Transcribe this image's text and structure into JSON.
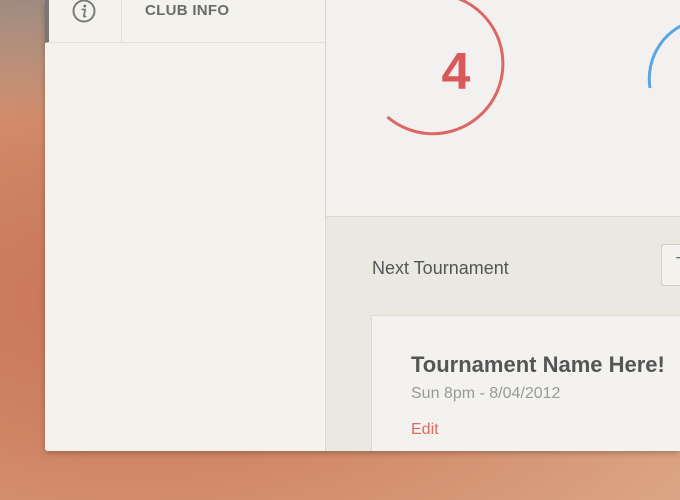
{
  "sidebar": {
    "items": [
      {
        "label": "CLUB INFO",
        "icon": "info-icon"
      }
    ]
  },
  "stats": {
    "counter": {
      "value": "4",
      "color": "#d9585a"
    },
    "second_ring_color": "#5aa6e0"
  },
  "next_tournament": {
    "section_title": "Next Tournament",
    "card": {
      "name": "Tournament Name Here!",
      "date": "Sun 8pm - 8/04/2012",
      "edit_label": "Edit"
    }
  }
}
